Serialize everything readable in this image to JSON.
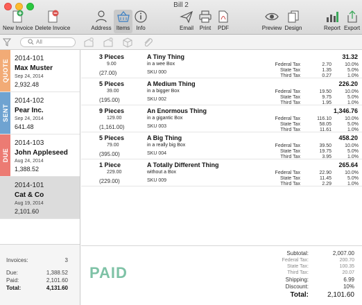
{
  "window": {
    "title": "Bill 2"
  },
  "toolbar": {
    "new_invoice": "New Invoice",
    "delete_invoice": "Delete Invoice",
    "address": "Address",
    "items": "Items",
    "info": "Info",
    "email": "Email",
    "print": "Print",
    "pdf": "PDF",
    "preview": "Preview",
    "design": "Design",
    "report": "Report",
    "export": "Export"
  },
  "search": {
    "placeholder": "All"
  },
  "colors": {
    "quote": "#f2ab76",
    "sent": "#6fa3d1",
    "due": "#ec7b73",
    "paid": "#7ec2a6"
  },
  "invoices": [
    {
      "status": "QUOTE",
      "number": "2014-101",
      "customer": "Max Muster",
      "date": "Sep 24, 2014",
      "amount": "2,932.48"
    },
    {
      "status": "SENT",
      "number": "2014-102",
      "customer": "Pear Inc.",
      "date": "Sep 24, 2014",
      "amount": "641.48"
    },
    {
      "status": "DUE",
      "number": "2014-103",
      "customer": "John Appleseed",
      "date": "Aug 24, 2014",
      "amount": "1,388.52"
    },
    {
      "status": "",
      "number": "2014-101",
      "customer": "Cat & Co",
      "date": "Aug 19, 2014",
      "amount": "2,101.60"
    }
  ],
  "summary": {
    "invoices_label": "Invoices:",
    "invoices_value": "3",
    "due_label": "Due:",
    "due_value": "1,388.52",
    "paid_label": "Paid:",
    "paid_value": "2,101.60",
    "total_label": "Total:",
    "total_value": "4,131.60"
  },
  "items": [
    {
      "qty": "3 Pieces",
      "unit_price": "9.00",
      "line_total": "(27.00)",
      "name": "A Tiny Thing",
      "desc": "in a wee Box",
      "sku": "SKU 000",
      "total": "31.32",
      "taxes": [
        {
          "name": "Federal Tax",
          "value": "2.70",
          "rate": "10.0%"
        },
        {
          "name": "State Tax",
          "value": "1.35",
          "rate": "5.0%"
        },
        {
          "name": "Third Tax",
          "value": "0.27",
          "rate": "1.0%"
        }
      ]
    },
    {
      "qty": "5 Pieces",
      "unit_price": "39.00",
      "line_total": "(195.00)",
      "name": "A Medium Thing",
      "desc": "in a bigger Box",
      "sku": "SKU 002",
      "total": "226.20",
      "taxes": [
        {
          "name": "Federal Tax",
          "value": "19.50",
          "rate": "10.0%"
        },
        {
          "name": "State Tax",
          "value": "9.75",
          "rate": "5.0%"
        },
        {
          "name": "Third Tax",
          "value": "1.95",
          "rate": "1.0%"
        }
      ]
    },
    {
      "qty": "9 Pieces",
      "unit_price": "129.00",
      "line_total": "(1,161.00)",
      "name": "An Enormous Thing",
      "desc": "in a gigantic Box",
      "sku": "SKU 003",
      "total": "1,346.76",
      "taxes": [
        {
          "name": "Federal Tax",
          "value": "116.10",
          "rate": "10.0%"
        },
        {
          "name": "State Tax",
          "value": "58.05",
          "rate": "5.0%"
        },
        {
          "name": "Third Tax",
          "value": "11.61",
          "rate": "1.0%"
        }
      ]
    },
    {
      "qty": "5 Pieces",
      "unit_price": "79.00",
      "line_total": "(395.00)",
      "name": "A Big Thing",
      "desc": "in a really big Box",
      "sku": "SKU 004",
      "total": "458.20",
      "taxes": [
        {
          "name": "Federal Tax",
          "value": "39.50",
          "rate": "10.0%"
        },
        {
          "name": "State Tax",
          "value": "19.75",
          "rate": "5.0%"
        },
        {
          "name": "Third Tax",
          "value": "3.95",
          "rate": "1.0%"
        }
      ]
    },
    {
      "qty": "1 Piece",
      "unit_price": "229.00",
      "line_total": "(229.00)",
      "name": "A Totally Different Thing",
      "desc": "without a Box",
      "sku": "SKU 009",
      "total": "265.64",
      "taxes": [
        {
          "name": "Federal Tax",
          "value": "22.90",
          "rate": "10.0%"
        },
        {
          "name": "State Tax",
          "value": "11.45",
          "rate": "5.0%"
        },
        {
          "name": "Third Tax",
          "value": "2.29",
          "rate": "1.0%"
        }
      ]
    }
  ],
  "totals": {
    "status": "PAID",
    "subtotal_label": "Subtotal:",
    "subtotal": "2,007.00",
    "federal_label": "Federal Tax:",
    "federal": "200.70",
    "state_label": "State Tax:",
    "state": "100.35",
    "third_label": "Third Tax:",
    "third": "20.07",
    "shipping_label": "Shipping:",
    "shipping": "6.99",
    "discount_label": "Discount:",
    "discount": "10%",
    "total_label": "Total:",
    "total": "2,101.60"
  }
}
